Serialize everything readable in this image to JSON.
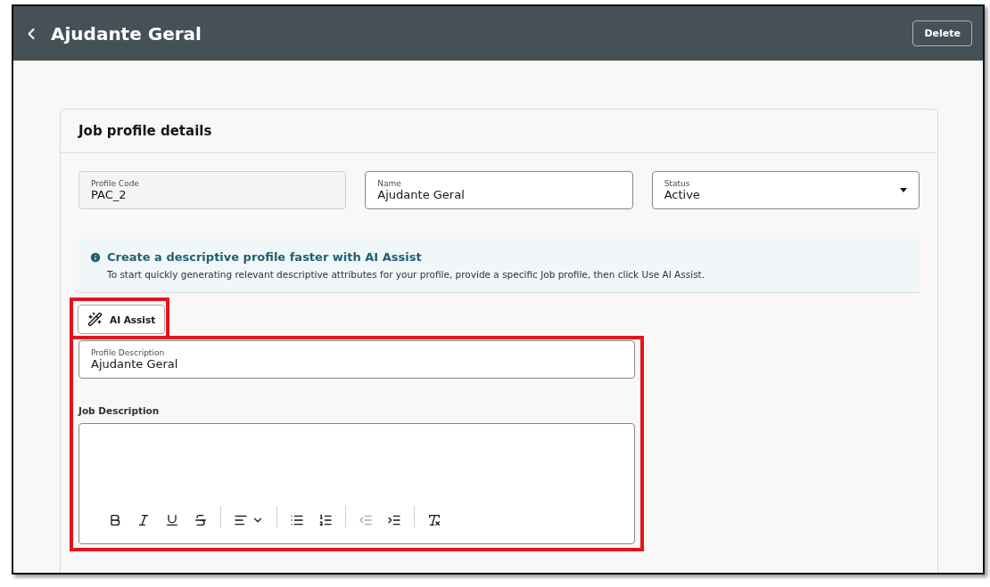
{
  "header": {
    "title": "Ajudante Geral",
    "delete_button": "Delete"
  },
  "card": {
    "title": "Job profile details",
    "fields": [
      {
        "label": "Profile Code",
        "value": "PAC_2",
        "kind": "readonly"
      },
      {
        "label": "Name",
        "value": "Ajudante Geral",
        "kind": "text"
      },
      {
        "label": "Status",
        "value": "Active",
        "kind": "select"
      }
    ],
    "banner": {
      "title": "Create a descriptive profile faster with AI Assist",
      "text": "To start quickly generating relevant descriptive attributes for your profile, provide a specific Job profile, then click Use AI Assist."
    },
    "ai_button": "AI Assist",
    "profile_description": {
      "label": "Profile Description",
      "value": "Ajudante Geral"
    },
    "job_description": {
      "label": "Job Description",
      "toolbar": [
        {
          "kind": "bold",
          "disabled": false
        },
        {
          "kind": "italic",
          "disabled": false
        },
        {
          "kind": "underline",
          "disabled": false
        },
        {
          "kind": "strike",
          "disabled": false
        },
        {
          "kind": "sep"
        },
        {
          "kind": "align",
          "disabled": false
        },
        {
          "kind": "sep"
        },
        {
          "kind": "bullets",
          "disabled": false
        },
        {
          "kind": "numbers",
          "disabled": false
        },
        {
          "kind": "sep"
        },
        {
          "kind": "outdent",
          "disabled": true
        },
        {
          "kind": "indent",
          "disabled": false
        },
        {
          "kind": "sep"
        },
        {
          "kind": "clear",
          "disabled": false
        }
      ]
    }
  }
}
